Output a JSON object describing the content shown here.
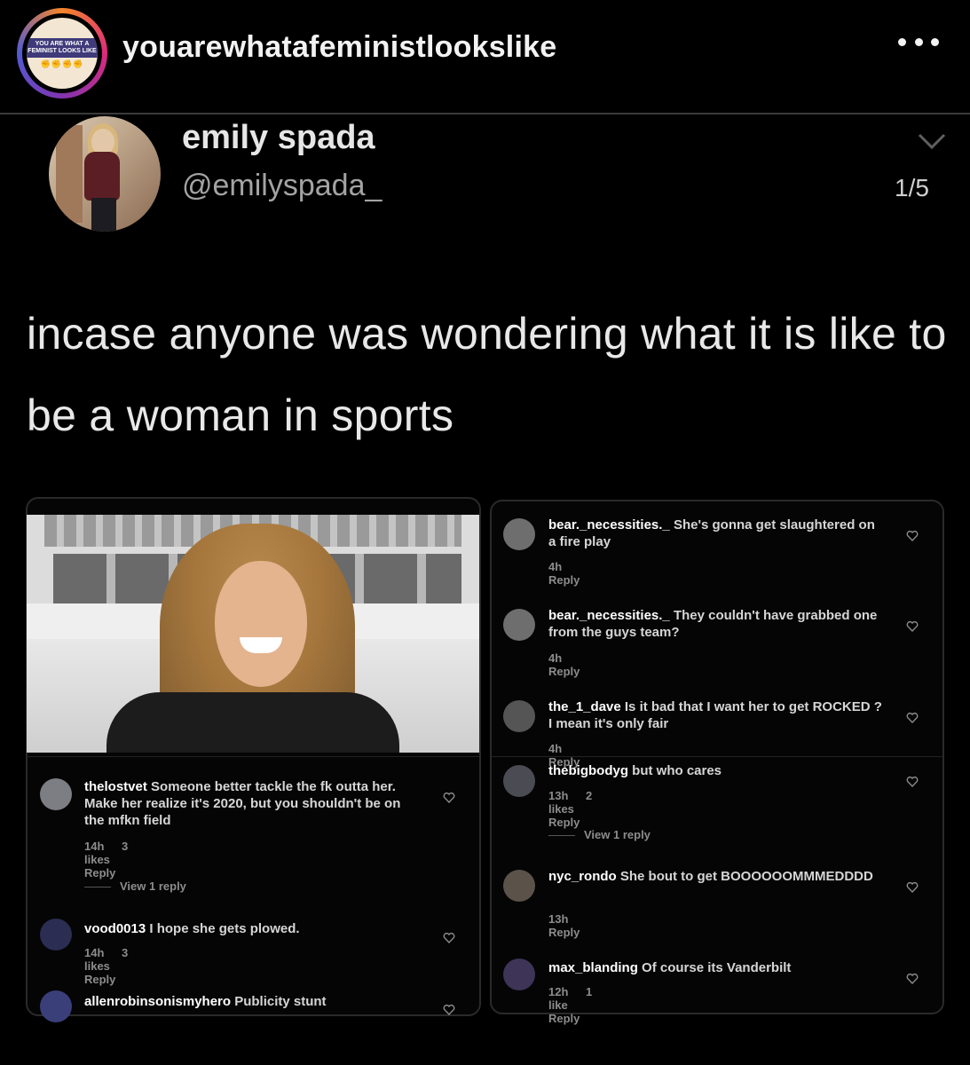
{
  "account": {
    "name": "youarewhatafeministlookslike",
    "avatar_text": "YOU ARE WHAT A FEMINIST LOOKS LIKE"
  },
  "tweet": {
    "author_name": "emily spada",
    "author_handle": "@emilyspada_",
    "slide_counter": "1/5",
    "text": "incase anyone was wondering what it is like to be a woman in sports"
  },
  "left_comments": [
    {
      "user": "thelostvet",
      "text": "Someone better tackle the fk outta her. Make her realize it's 2020, but you shouldn't be on the mfkn field",
      "time": "14h",
      "likes": "3 likes",
      "reply": "Reply"
    },
    {
      "user": "vood0013",
      "text": "I hope she gets plowed.",
      "time": "14h",
      "likes": "3 likes",
      "reply": "Reply"
    },
    {
      "user": "allenrobinsonismyhero",
      "text": "Publicity stunt"
    }
  ],
  "left_view_replies": "View 1 reply",
  "right_comments": [
    {
      "user": "bear._necessities._",
      "text": "She's gonna get slaughtered on a fire play",
      "time": "4h",
      "reply": "Reply"
    },
    {
      "user": "bear._necessities._",
      "text": "They couldn't have grabbed one from the guys team?",
      "time": "4h",
      "reply": "Reply"
    },
    {
      "user": "the_1_dave",
      "text": "Is it bad that I want her to get ROCKED ? I mean it's only fair",
      "time": "4h",
      "reply": "Reply"
    },
    {
      "user": "thebigbodyg",
      "text": "but who cares",
      "time": "13h",
      "likes": "2 likes",
      "reply": "Reply"
    },
    {
      "user": "nyc_rondo",
      "text": "She bout to get BOOOOOOMMMEDDDD",
      "time": "13h",
      "reply": "Reply"
    },
    {
      "user": "max_blanding",
      "text": "Of course its Vanderbilt",
      "time": "12h",
      "likes": "1 like",
      "reply": "Reply"
    }
  ],
  "right_view_replies": "View 1 reply"
}
